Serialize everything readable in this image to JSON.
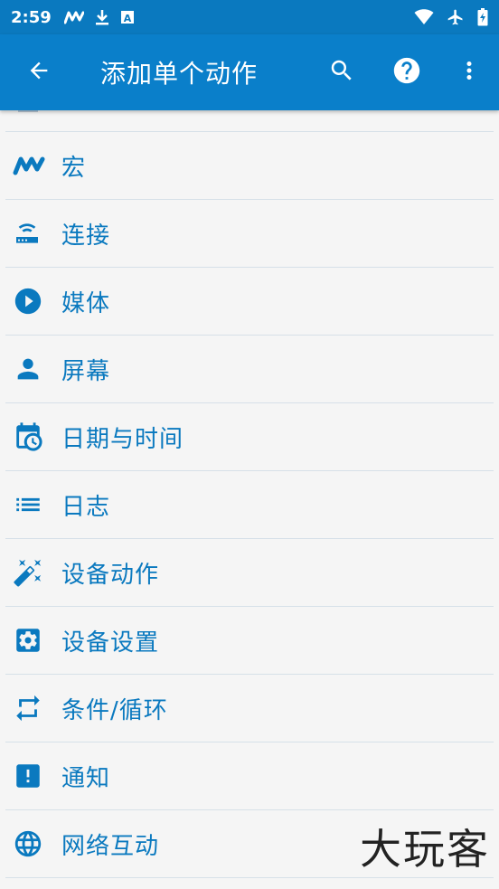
{
  "status_bar": {
    "time": "2:59",
    "icons": [
      "macrodroid-icon",
      "download-icon",
      "text-icon",
      "wifi-icon",
      "airplane-icon",
      "battery-icon"
    ]
  },
  "app_bar": {
    "title": "添加单个动作",
    "actions": [
      "search-icon",
      "help-icon",
      "more-vert-icon"
    ]
  },
  "list": {
    "items": [
      {
        "label": "宏",
        "icon": "macro-icon"
      },
      {
        "label": "连接",
        "icon": "router-icon"
      },
      {
        "label": "媒体",
        "icon": "play-circle-icon"
      },
      {
        "label": "屏幕",
        "icon": "person-icon"
      },
      {
        "label": "日期与时间",
        "icon": "calendar-clock-icon"
      },
      {
        "label": "日志",
        "icon": "list-icon"
      },
      {
        "label": "设备动作",
        "icon": "magic-wand-icon"
      },
      {
        "label": "设备设置",
        "icon": "settings-box-icon"
      },
      {
        "label": "条件/循环",
        "icon": "repeat-icon"
      },
      {
        "label": "通知",
        "icon": "alert-box-icon"
      },
      {
        "label": "网络互动",
        "icon": "globe-icon"
      }
    ]
  },
  "watermark": "大玩客",
  "colors": {
    "primary": "#0a7fca",
    "status_bar": "#0a79bf",
    "accent_text": "#0a79bf",
    "background": "#f5f5f5",
    "divider": "#d6e0e8"
  }
}
